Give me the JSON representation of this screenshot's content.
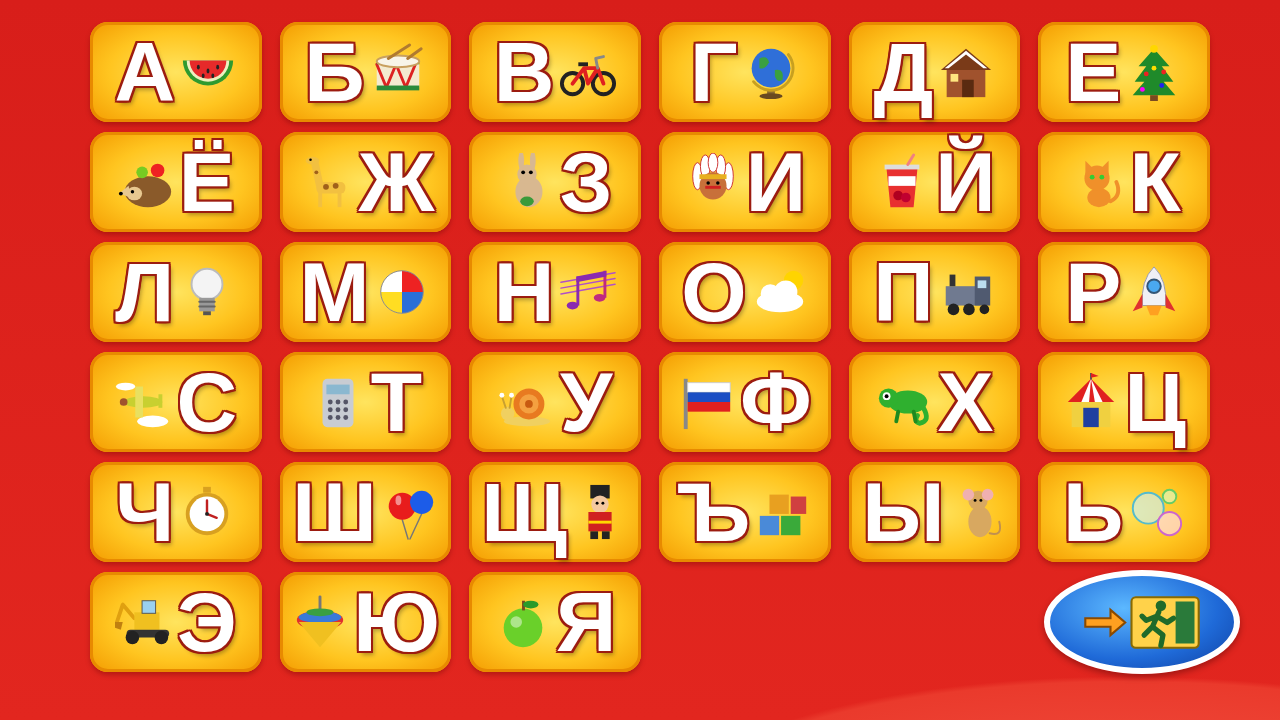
{
  "letters": [
    {
      "text": "А"
    },
    {
      "text": "Б"
    },
    {
      "text": "В"
    },
    {
      "text": "Г"
    },
    {
      "text": "Д"
    },
    {
      "text": "Е"
    },
    {
      "text": "Ё"
    },
    {
      "text": "Ж"
    },
    {
      "text": "З"
    },
    {
      "text": "И"
    },
    {
      "text": "Й"
    },
    {
      "text": "К"
    },
    {
      "text": "Л"
    },
    {
      "text": "М"
    },
    {
      "text": "Н"
    },
    {
      "text": "О"
    },
    {
      "text": "П"
    },
    {
      "text": "Р"
    },
    {
      "text": "С"
    },
    {
      "text": "Т"
    },
    {
      "text": "У"
    },
    {
      "text": "Ф"
    },
    {
      "text": "Х"
    },
    {
      "text": "Ц"
    },
    {
      "text": "Ч"
    },
    {
      "text": "Ш"
    },
    {
      "text": "Щ"
    },
    {
      "text": "Ъ"
    },
    {
      "text": "Ы"
    },
    {
      "text": "Ь"
    },
    {
      "text": "Э"
    },
    {
      "text": "Ю"
    },
    {
      "text": "Я"
    }
  ]
}
